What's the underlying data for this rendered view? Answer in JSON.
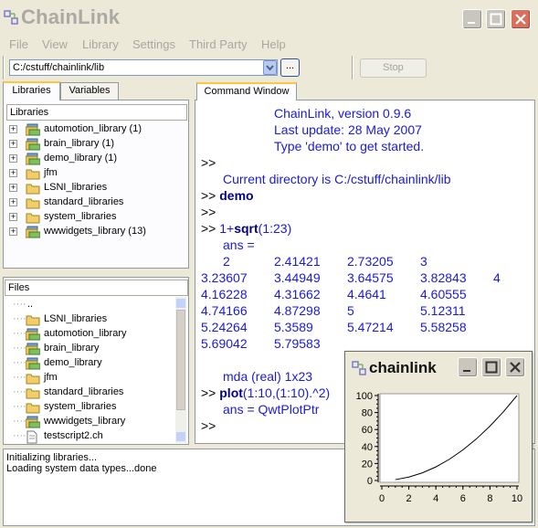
{
  "window": {
    "title": "ChainLink"
  },
  "menu": [
    "File",
    "View",
    "Library",
    "Settings",
    "Third Party",
    "Help"
  ],
  "toolbar": {
    "path": "C:/cstuff/chainlink/lib",
    "browse_label": "...",
    "stop_label": "Stop"
  },
  "left_tabs": [
    "Libraries",
    "Variables"
  ],
  "libraries": {
    "header": "Libraries",
    "items": [
      "automotion_library (1)",
      "brain_library (1)",
      "demo_library (1)",
      "jfm",
      "LSNI_libraries",
      "standard_libraries",
      "system_libraries",
      "wwwidgets_library (13)"
    ]
  },
  "files": {
    "header": "Files",
    "items": [
      "..",
      "LSNI_libraries",
      "automotion_library",
      "brain_library",
      "demo_library",
      "jfm",
      "standard_libraries",
      "system_libraries",
      "wwwidgets_library",
      "testscript2.ch"
    ]
  },
  "command_window": {
    "tab": "Command Window",
    "banner": [
      "ChainLink, version 0.9.6",
      "Last update: 28 May 2007",
      "Type 'demo' to get started."
    ],
    "prompt": ">>",
    "current_dir": "Current directory is C:/cstuff/chainlink/lib",
    "cmd_demo": "demo",
    "cmd_sqrt_prefix": "1+",
    "cmd_sqrt_fn": "sqrt",
    "cmd_sqrt_suffix": "(1:23)",
    "ans_label": "ans =",
    "values": [
      [
        "2",
        "2.41421",
        "2.73205",
        "3",
        ""
      ],
      [
        "3.23607",
        "3.44949",
        "3.64575",
        "3.82843",
        "4"
      ],
      [
        "4.16228",
        "4.31662",
        "4.4641",
        "4.60555",
        ""
      ],
      [
        "4.74166",
        "4.87298",
        "5",
        "5.12311",
        ""
      ],
      [
        "5.24264",
        "5.3589",
        "5.47214",
        "5.58258",
        ""
      ],
      [
        "5.69042",
        "5.79583",
        "",
        "",
        ""
      ]
    ],
    "mda_line": "mda (real) 1x23",
    "cmd_plot_fn": "plot",
    "cmd_plot_args": "(1:10,(1:10).^2)",
    "ans_plot": "ans = QwtPlotPtr"
  },
  "status": [
    "Initializing libraries...",
    "Loading system data types...done"
  ],
  "plot_window": {
    "title": "chainlink",
    "chart_data": {
      "type": "line",
      "x": [
        1,
        2,
        3,
        4,
        5,
        6,
        7,
        8,
        9,
        10
      ],
      "y": [
        1,
        4,
        9,
        16,
        25,
        36,
        49,
        64,
        81,
        100
      ],
      "xlim": [
        0,
        10
      ],
      "ylim": [
        0,
        100
      ],
      "xticks": [
        "0",
        "2",
        "4",
        "6",
        "8",
        "10"
      ],
      "yticks": [
        "0",
        "20",
        "40",
        "60",
        "80",
        "100"
      ],
      "line_color": "#000000"
    }
  },
  "colors": {
    "command_blue": "#1a1adc",
    "command_bold": "#00008b",
    "close_red": "#d8705b"
  }
}
